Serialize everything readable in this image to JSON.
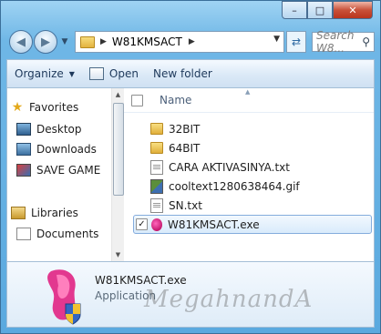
{
  "window": {
    "controls": {
      "minimize": "–",
      "maximize": "□",
      "close": "✕"
    }
  },
  "address_bar": {
    "breadcrumb_sep": "▶",
    "path": "W81KMSACT",
    "crumb_arrow": "▶",
    "dropdown": "▼"
  },
  "search": {
    "placeholder": "Search W8..."
  },
  "toolbar": {
    "organize_label": "Organize",
    "open_label": "Open",
    "new_folder_label": "New folder",
    "caret": "▼"
  },
  "nav_pane": {
    "items": [
      {
        "label": "Favorites",
        "icon": "star-icon"
      },
      {
        "label": "Desktop",
        "icon": "desktop-icon"
      },
      {
        "label": "Downloads",
        "icon": "downloads-icon"
      },
      {
        "label": "SAVE GAME",
        "icon": "save-game-icon"
      },
      {
        "label": "Libraries",
        "icon": "libraries-icon"
      },
      {
        "label": "Documents",
        "icon": "documents-icon"
      }
    ]
  },
  "file_pane": {
    "column_name": "Name",
    "sort_arrow": "▲",
    "files": [
      {
        "name": "32BIT",
        "type": "folder",
        "checked": false
      },
      {
        "name": "64BIT",
        "type": "folder",
        "checked": false
      },
      {
        "name": "CARA AKTIVASINYA.txt",
        "type": "txt",
        "checked": false
      },
      {
        "name": "cooltext1280638464.gif",
        "type": "gif",
        "checked": false
      },
      {
        "name": "SN.txt",
        "type": "txt",
        "checked": false
      },
      {
        "name": "W81KMSACT.exe",
        "type": "exe",
        "checked": true
      }
    ],
    "check_mark": "✓"
  },
  "details": {
    "file_name": "W81KMSACT.exe",
    "file_type": "Application",
    "watermark": "MegahnandA"
  },
  "colors": {
    "title_bar": "#6fb7e6",
    "selection_border": "#84acdd",
    "folder": "#e1b03b",
    "close_button": "#c9513a"
  }
}
